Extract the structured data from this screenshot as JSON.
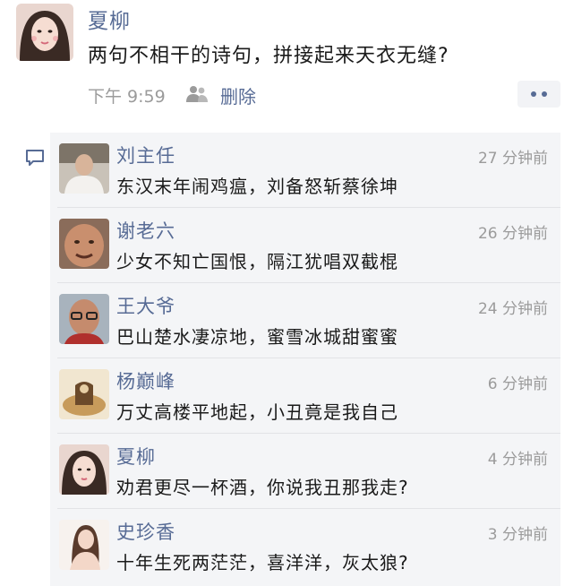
{
  "post": {
    "author": "夏柳",
    "text": "两句不相干的诗句，拼接起来天衣无缝?",
    "time": "下午 9:59",
    "delete_label": "删除",
    "people_icon": "people-icon",
    "more_icon": "more-dots-icon"
  },
  "comments": [
    {
      "name": "刘主任",
      "time": "27 分钟前",
      "text": "东汉末年闹鸡瘟，刘备怒斩蔡徐坤"
    },
    {
      "name": "谢老六",
      "time": "26 分钟前",
      "text": "少女不知亡国恨，隔江犹唱双截棍"
    },
    {
      "name": "王大爷",
      "time": "24 分钟前",
      "text": "巴山楚水凄凉地，蜜雪冰城甜蜜蜜"
    },
    {
      "name": "杨巅峰",
      "time": "6 分钟前",
      "text": "万丈高楼平地起，小丑竟是我自己"
    },
    {
      "name": "夏柳",
      "time": "4 分钟前",
      "text": "劝君更尽一杯酒，你说我丑那我走?"
    },
    {
      "name": "史珍香",
      "time": "3 分钟前",
      "text": "十年生死两茫茫，喜洋洋，灰太狼?"
    }
  ],
  "colors": {
    "link": "#576b95",
    "meta": "#9b9b9b",
    "comment_bg": "#f4f5f7"
  }
}
